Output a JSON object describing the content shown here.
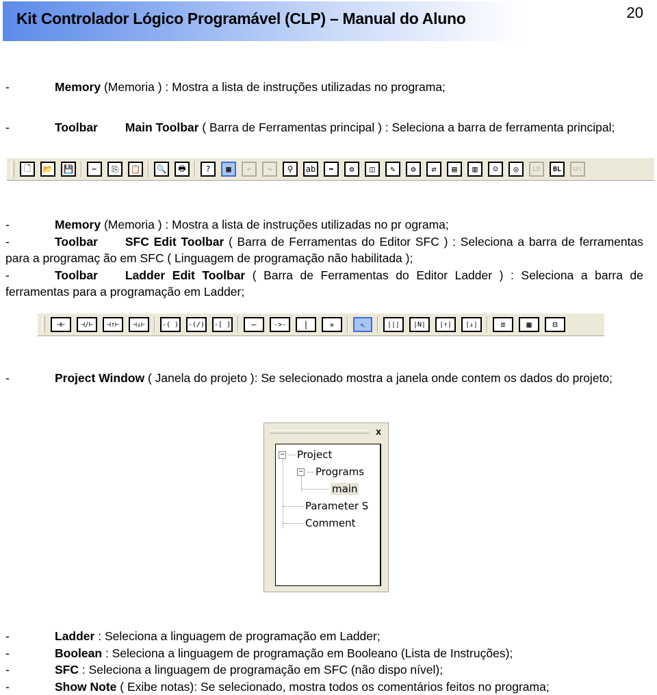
{
  "header": {
    "title": "Kit Controlador Lógico Programável (CLP) – Manual do Aluno",
    "page_number": "20"
  },
  "sections": {
    "memory1": {
      "dash": "-",
      "term": "Memory",
      "text": " (Memoria ) : Mostra a lista de instruções utilizadas no programa;"
    },
    "main_toolbar": {
      "dash": "-",
      "term": "Toolbar",
      "subterm": "Main Toolbar",
      "text": " ( Barra de Ferramentas principal ) : Seleciona a barra de ferramenta principal;"
    },
    "memory2": {
      "dash": "-",
      "term": "Memory",
      "text": " (Memoria ) : Mostra a lista de instruções utilizadas no pr ograma;"
    },
    "sfc_toolbar": {
      "dash": "-",
      "term": "Toolbar",
      "subterm": "SFC Edit Toolbar",
      "text": " ( Barra de Ferramentas do Editor SFC ) : Seleciona a barra de ferramentas para a programaç ão em SFC ( Linguagem de programação não habilitada );"
    },
    "ladder_toolbar": {
      "dash": "-",
      "term": "Toolbar",
      "subterm": "Ladder Edit Toolbar",
      "text": " ( Barra de Ferramentas do Editor Ladder ) : Seleciona a barra de ferramentas para a programação em Ladder;"
    },
    "project_window": {
      "dash": "-",
      "term": "Project Window",
      "text": " ( Janela do projeto ): Se selecionado mostra a janela onde contem os dados do projeto;"
    },
    "ladder": {
      "dash": "-",
      "term": "Ladder",
      "text": " : Seleciona a linguagem de programação em Ladder;"
    },
    "boolean": {
      "dash": "-",
      "term": "Boolean",
      "text": " : Seleciona a linguagem de programação em Booleano (Lista de Instruções);"
    },
    "sfc": {
      "dash": "-",
      "term": "SFC",
      "text": " : Seleciona a linguagem de programação em SFC (não dispo nível);"
    },
    "show_note": {
      "dash": "-",
      "term": "Show Note",
      "text": " ( Exibe notas): Se selecionado, mostra todos os comentários feitos no programa;"
    }
  },
  "main_toolbar_icons": {
    "new": "🗋",
    "open": "📂",
    "save": "💾",
    "cut": "✂",
    "copy": "⎘",
    "paste": "📋",
    "preview": "🔍",
    "print": "🖶",
    "help": "?",
    "view": "▦",
    "undo": "↶",
    "redo": "↷",
    "find": "⚲",
    "replace": "ab",
    "goto": "➡",
    "i1": "⚙",
    "i2": "◫",
    "i3": "✎",
    "i4": "⚙",
    "i5": "⇄",
    "i6": "▤",
    "i7": "▥",
    "i8": "☺",
    "i9": "◎",
    "ld": "LD",
    "bl": "BL",
    "sfc": "SFC"
  },
  "ladder_toolbar_icons": {
    "no": "⊣⊢",
    "nc": "⊣/⊢",
    "pos": "⊣↑⊢",
    "neg": "⊣↓⊢",
    "coil": "-( )",
    "ncoil": "-(/)",
    "func": "-[ ]",
    "hline": "—",
    "del": "->-",
    "vline": "|",
    "vdel": "✳",
    "select": "⇖",
    "p1": "|||",
    "p2": "|N|",
    "p3": "|↑|",
    "p4": "|↓|",
    "r1": "≡",
    "r2": "▦",
    "r3": "⊟"
  },
  "project_window": {
    "close": "x",
    "tree": {
      "root": "Project",
      "programs": "Programs",
      "main": "main",
      "parameter": "Parameter S",
      "comment": "Comment",
      "collapse": "−"
    }
  }
}
